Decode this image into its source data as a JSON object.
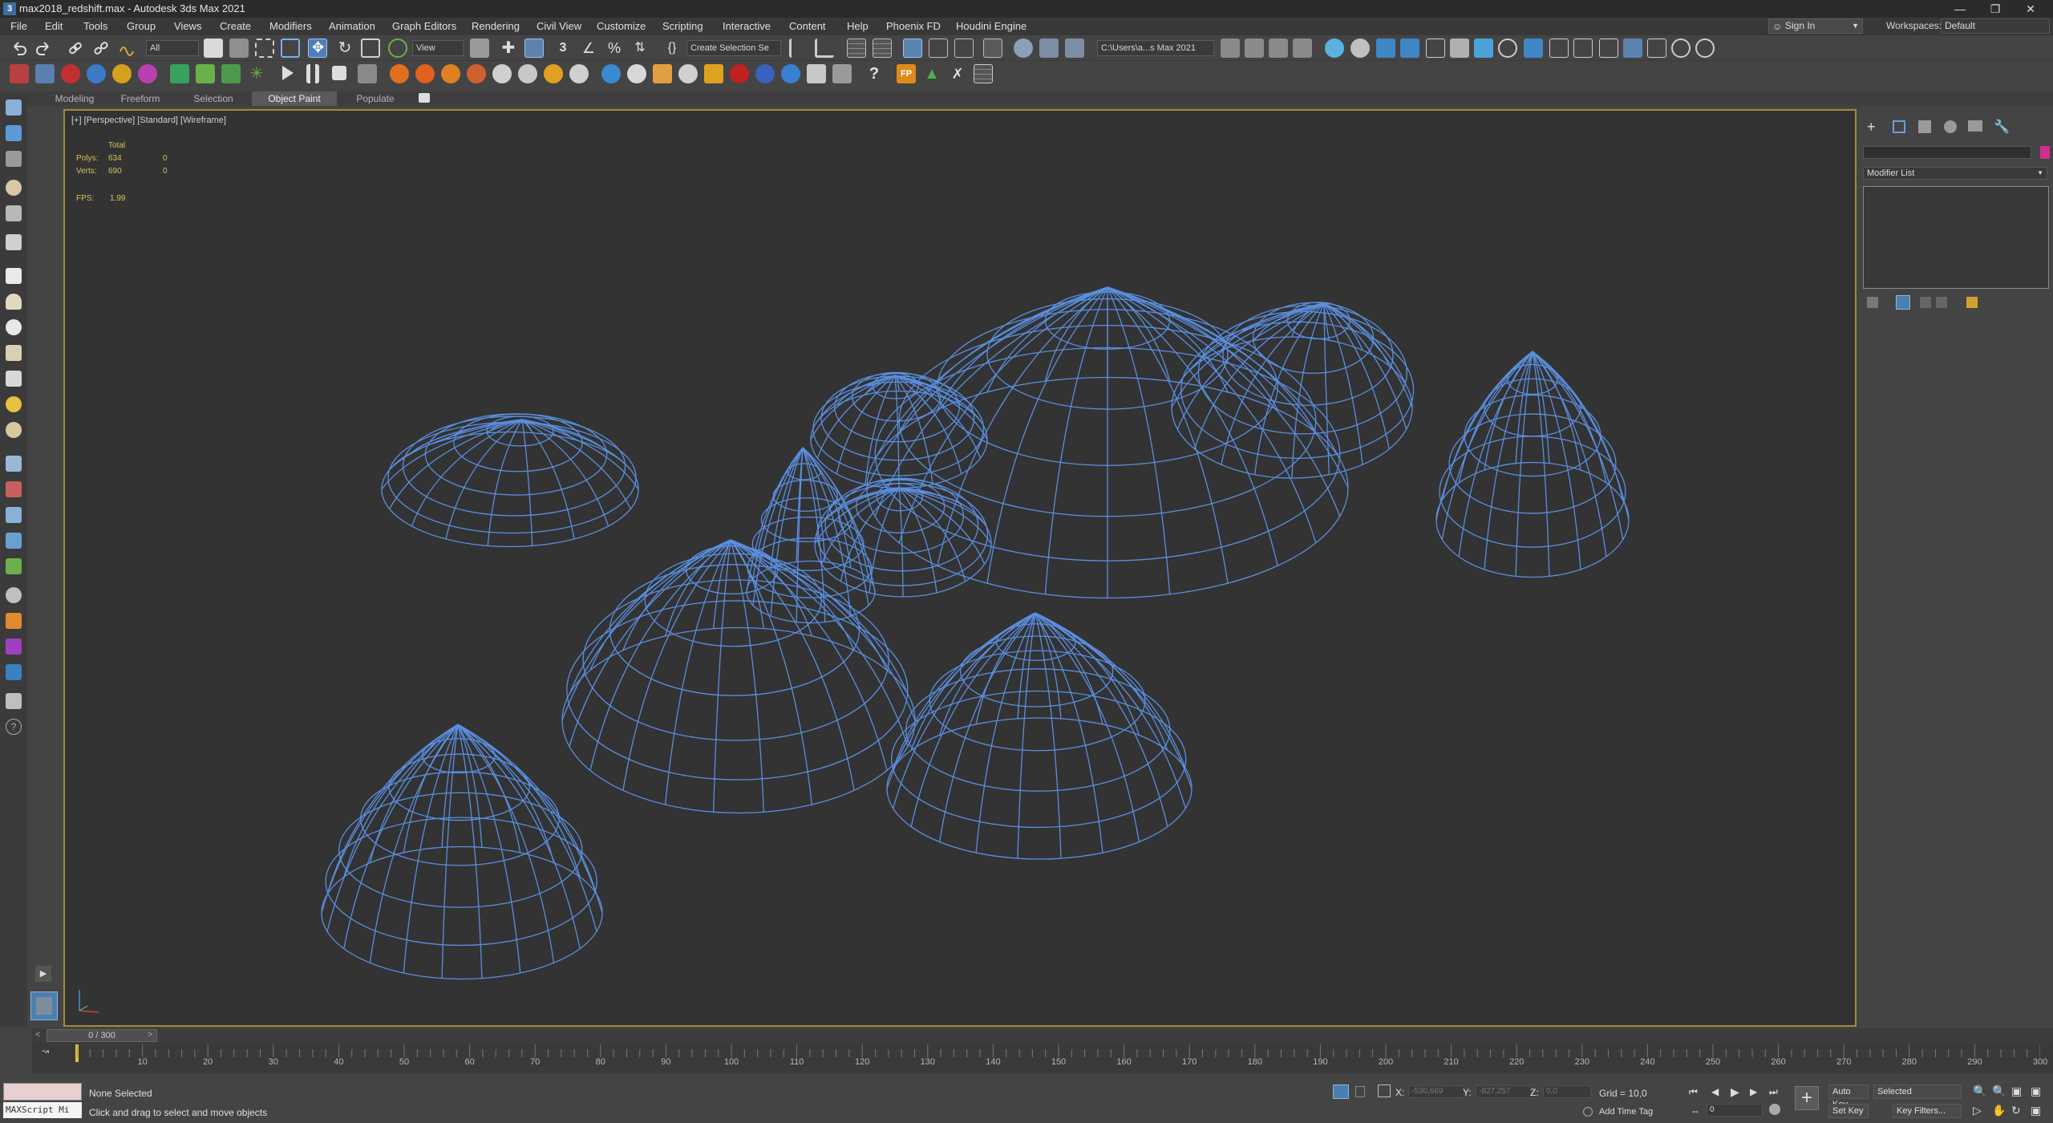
{
  "window": {
    "title": "max2018_redshift.max - Autodesk 3ds Max 2021",
    "icon_letter": "3",
    "controls": [
      "—",
      "❐",
      "✕"
    ]
  },
  "menus": [
    "File",
    "Edit",
    "Tools",
    "Group",
    "Views",
    "Create",
    "Modifiers",
    "Animation",
    "Graph Editors",
    "Rendering",
    "Civil View",
    "Customize",
    "Scripting",
    "Interactive",
    "Content",
    "Help",
    "Phoenix FD",
    "Houdini Engine"
  ],
  "account": {
    "sign_in": "Sign In",
    "workspaces_label": "Workspaces:",
    "workspace": "Default"
  },
  "toolbar": {
    "selection_filter": "All",
    "ref_coord": "View",
    "named_selection": "Create Selection Se",
    "project_path": "C:\\Users\\a...s Max 2021"
  },
  "ribbon_tabs": [
    "Modeling",
    "Freeform",
    "Selection",
    "Object Paint",
    "Populate"
  ],
  "active_ribbon_tab": "Object Paint",
  "viewport": {
    "label": "[+] [Perspective] [Standard] [Wireframe]",
    "stats": {
      "total_header": "Total",
      "polys_label": "Polys:",
      "polys_total": "634",
      "polys_sel": "0",
      "verts_label": "Verts:",
      "verts_total": "690",
      "verts_sel": "0",
      "fps_label": "FPS:",
      "fps": "1,99"
    },
    "wire_color": "#5a8fe0"
  },
  "command_panel": {
    "modifier_list": "Modifier List",
    "color": "#d1308f"
  },
  "timeline": {
    "slider_label": "0 / 300",
    "ticks": [
      "10",
      "20",
      "30",
      "40",
      "50",
      "60",
      "70",
      "80",
      "90",
      "100",
      "110",
      "120",
      "130",
      "140",
      "150",
      "160",
      "170",
      "180",
      "190",
      "200",
      "210",
      "220",
      "230",
      "240",
      "250",
      "260",
      "270",
      "280",
      "290",
      "300"
    ]
  },
  "status": {
    "maxscript": "MAXScript Mi",
    "selection": "None Selected",
    "prompt": "Click and drag to select and move objects",
    "x_label": "X:",
    "x_value": "-530,669",
    "y_label": "Y:",
    "y_value": "-827,257",
    "z_label": "Z:",
    "z_value": "0,0",
    "grid": "Grid = 10,0",
    "add_time_tag": "Add Time Tag",
    "auto_key": "Auto Key",
    "key_mode": "Selected",
    "set_key": "Set Key",
    "key_filters": "Key Filters...",
    "frame": "0"
  }
}
